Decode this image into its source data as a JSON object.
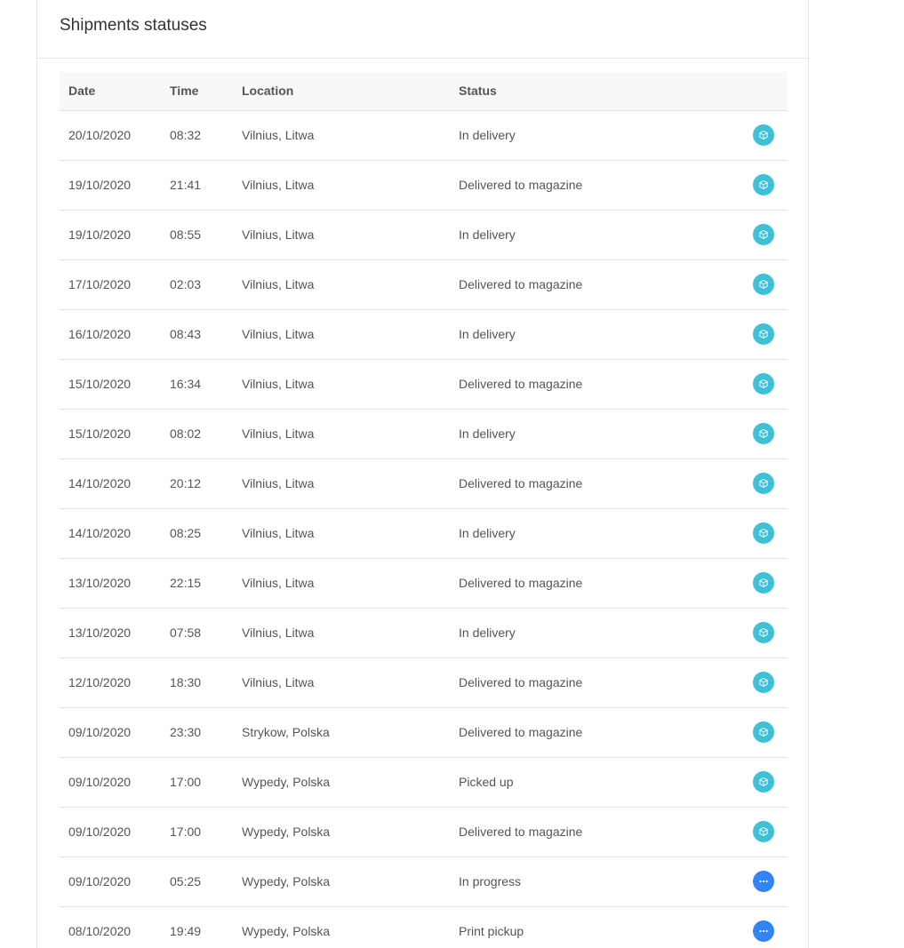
{
  "card": {
    "title": "Shipments statuses"
  },
  "colors": {
    "box_icon_bg": "#3ec0d8",
    "dots_icon_bg": "#3284f5",
    "icon_fg": "#ffffff"
  },
  "table": {
    "headers": {
      "date": "Date",
      "time": "Time",
      "location": "Location",
      "status": "Status"
    },
    "rows": [
      {
        "date": "20/10/2020",
        "time": "08:32",
        "location": "Vilnius, Litwa",
        "status": "In delivery",
        "icon": "box-icon"
      },
      {
        "date": "19/10/2020",
        "time": "21:41",
        "location": "Vilnius, Litwa",
        "status": "Delivered to magazine",
        "icon": "box-icon"
      },
      {
        "date": "19/10/2020",
        "time": "08:55",
        "location": "Vilnius, Litwa",
        "status": "In delivery",
        "icon": "box-icon"
      },
      {
        "date": "17/10/2020",
        "time": "02:03",
        "location": "Vilnius, Litwa",
        "status": "Delivered to magazine",
        "icon": "box-icon"
      },
      {
        "date": "16/10/2020",
        "time": "08:43",
        "location": "Vilnius, Litwa",
        "status": "In delivery",
        "icon": "box-icon"
      },
      {
        "date": "15/10/2020",
        "time": "16:34",
        "location": "Vilnius, Litwa",
        "status": "Delivered to magazine",
        "icon": "box-icon"
      },
      {
        "date": "15/10/2020",
        "time": "08:02",
        "location": "Vilnius, Litwa",
        "status": "In delivery",
        "icon": "box-icon"
      },
      {
        "date": "14/10/2020",
        "time": "20:12",
        "location": "Vilnius, Litwa",
        "status": "Delivered to magazine",
        "icon": "box-icon"
      },
      {
        "date": "14/10/2020",
        "time": "08:25",
        "location": "Vilnius, Litwa",
        "status": "In delivery",
        "icon": "box-icon"
      },
      {
        "date": "13/10/2020",
        "time": "22:15",
        "location": "Vilnius, Litwa",
        "status": "Delivered to magazine",
        "icon": "box-icon"
      },
      {
        "date": "13/10/2020",
        "time": "07:58",
        "location": "Vilnius, Litwa",
        "status": "In delivery",
        "icon": "box-icon"
      },
      {
        "date": "12/10/2020",
        "time": "18:30",
        "location": "Vilnius, Litwa",
        "status": "Delivered to magazine",
        "icon": "box-icon"
      },
      {
        "date": "09/10/2020",
        "time": "23:30",
        "location": "Strykow, Polska",
        "status": "Delivered to magazine",
        "icon": "box-icon"
      },
      {
        "date": "09/10/2020",
        "time": "17:00",
        "location": "Wypedy, Polska",
        "status": "Picked up",
        "icon": "box-icon"
      },
      {
        "date": "09/10/2020",
        "time": "17:00",
        "location": "Wypedy, Polska",
        "status": "Delivered to magazine",
        "icon": "box-icon"
      },
      {
        "date": "09/10/2020",
        "time": "05:25",
        "location": "Wypedy, Polska",
        "status": "In progress",
        "icon": "more-dots-icon"
      },
      {
        "date": "08/10/2020",
        "time": "19:49",
        "location": "Wypedy, Polska",
        "status": "Print pickup",
        "icon": "more-dots-icon"
      }
    ]
  }
}
